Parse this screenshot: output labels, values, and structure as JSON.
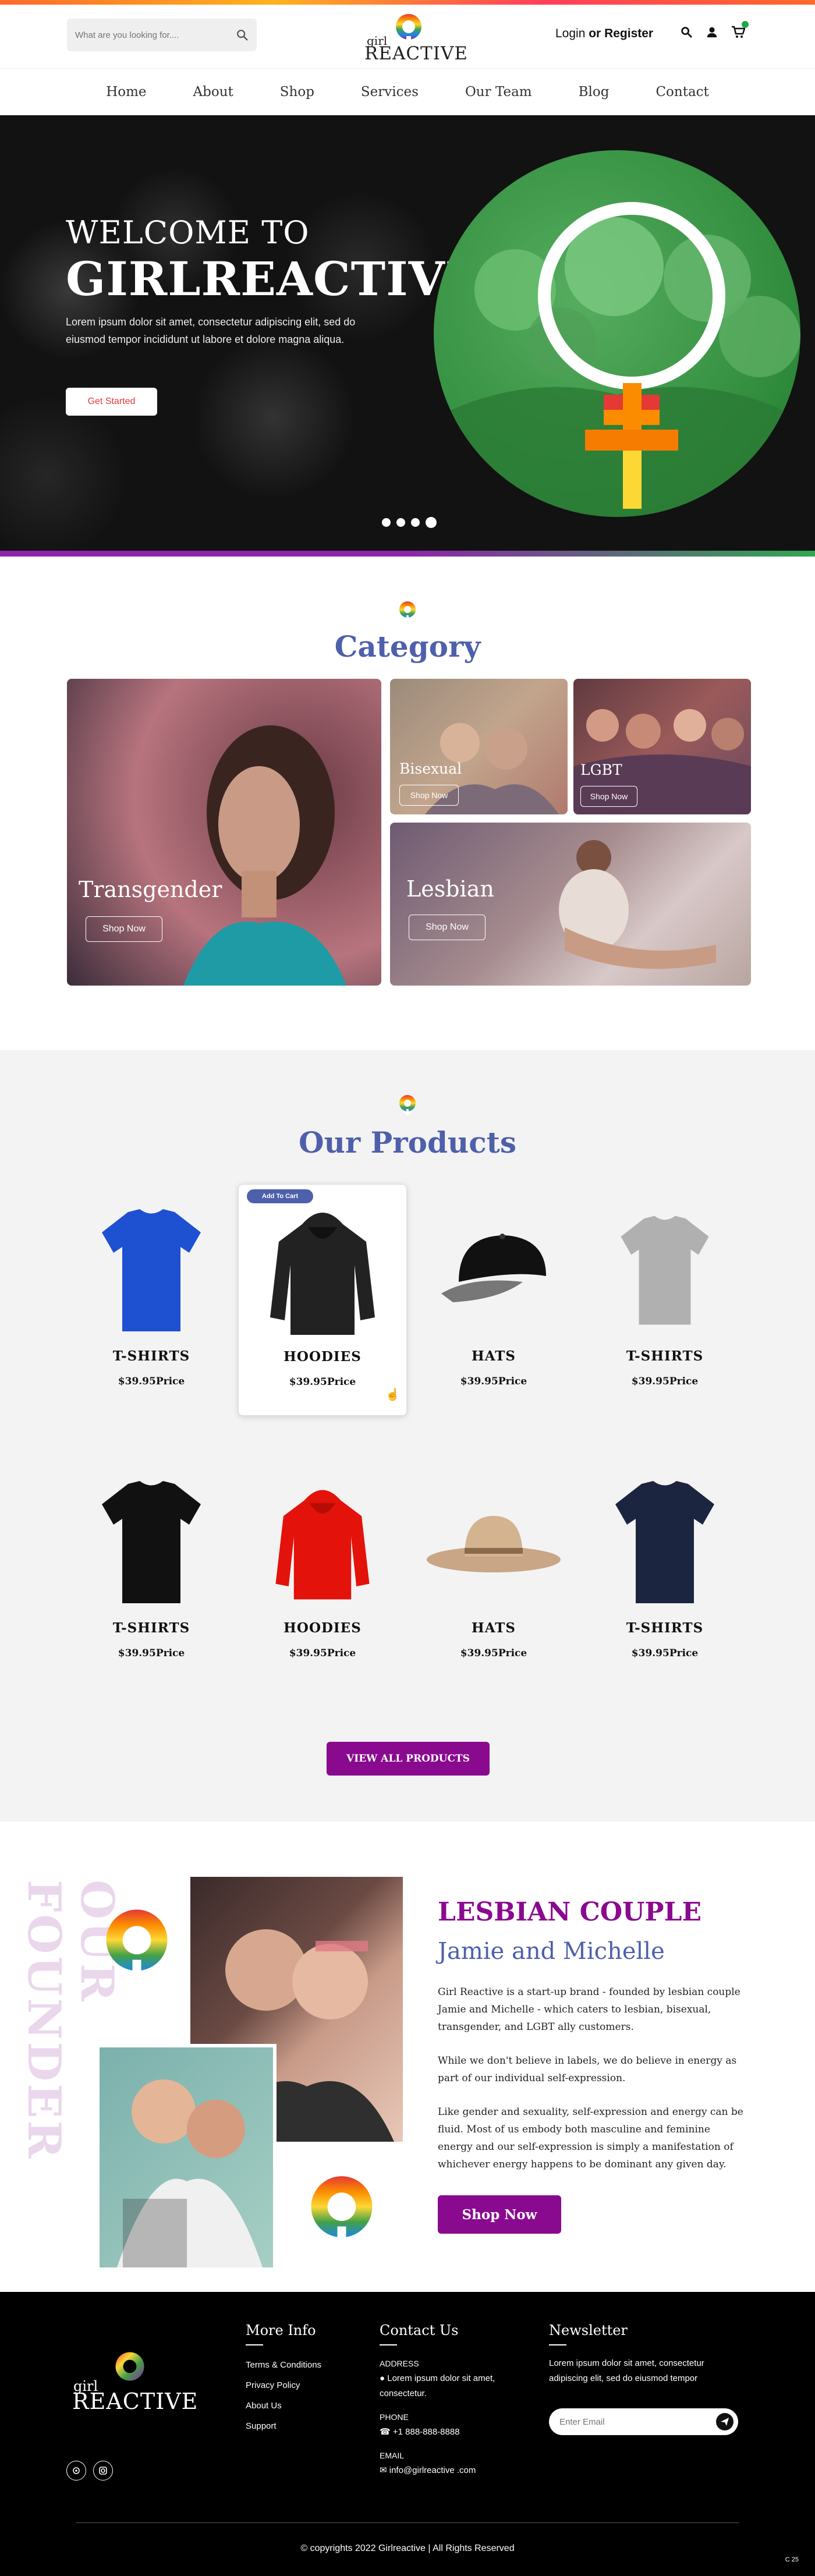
{
  "search": {
    "placeholder": "What are you looking for...."
  },
  "logo": {
    "top": "girl",
    "bottom": "REACTIVE"
  },
  "header": {
    "login": "Login",
    "or_register": "or Register"
  },
  "nav": [
    "Home",
    "About",
    "Shop",
    "Services",
    "Our Team",
    "Blog",
    "Contact"
  ],
  "hero": {
    "welcome": "WELCOME TO",
    "title": "GIRLREACTIVE",
    "text": "Lorem ipsum dolor sit amet, consectetur adipiscing elit, sed do eiusmod tempor incididunt ut labore et dolore magna aliqua.",
    "button": "Get Started"
  },
  "category": {
    "title": "Category",
    "items": [
      {
        "label": "Transgender",
        "button": "Shop Now"
      },
      {
        "label": "Bisexual",
        "button": "Shop Now"
      },
      {
        "label": "LGBT",
        "button": "Shop Now"
      },
      {
        "label": "Lesbian",
        "button": "Shop Now"
      }
    ]
  },
  "products": {
    "title": "Our Products",
    "add_to_cart": "Add To Cart",
    "items": [
      {
        "name": "T-SHIRTS",
        "price": "$39.95Price"
      },
      {
        "name": "HOODIES",
        "price": "$39.95Price"
      },
      {
        "name": "HATS",
        "price": "$39.95Price"
      },
      {
        "name": "T-SHIRTS",
        "price": "$39.95Price"
      },
      {
        "name": "T-SHIRTS",
        "price": "$39.95Price"
      },
      {
        "name": "HOODIES",
        "price": "$39.95Price"
      },
      {
        "name": "HATS",
        "price": "$39.95Price"
      },
      {
        "name": "T-SHIRTS",
        "price": "$39.95Price"
      }
    ],
    "view_all": "VIEW ALL PRODUCTS"
  },
  "founder": {
    "vertical": "OUR FOUNDER",
    "title": "LESBIAN COUPLE",
    "subtitle": "Jamie and Michelle",
    "p1": "Girl Reactive is a start-up brand - founded by lesbian couple Jamie and Michelle - which caters to lesbian, bisexual, transgender, and LGBT ally customers.",
    "p2": "While we don't believe in labels, we do believe in energy as part of our individual self-expression.",
    "p3": "Like gender and sexuality, self-expression and energy can be fluid.  Most of us embody both masculine and feminine energy and our self-expression is simply a manifestation of whichever energy happens to be dominant any given day.",
    "button": "Shop Now"
  },
  "footer": {
    "more_info": "More Info",
    "links": [
      "Terms & Conditions",
      "Privacy Policy",
      "About Us",
      "Support"
    ],
    "contact": "Contact Us",
    "address_label": "ADDRESS",
    "address": "Lorem ipsum dolor sit amet, consectetur.",
    "phone_label": "PHONE",
    "phone": "+1 888-888-8888",
    "email_label": "EMAIL",
    "email": "info@girlreactive .com",
    "newsletter": "Newsletter",
    "newsletter_text": "Lorem ipsum dolor sit amet, consectetur adipiscing elit, sed do eiusmod tempor",
    "email_placeholder": "Enter Email",
    "copyright": "© copyrights 2022 Girlreactive  |  All Rights Reserved",
    "counter": "C 25"
  },
  "colors": {
    "purple": "#8a0a8f",
    "blue": "#4e60aa",
    "green": "#2fa84f"
  }
}
